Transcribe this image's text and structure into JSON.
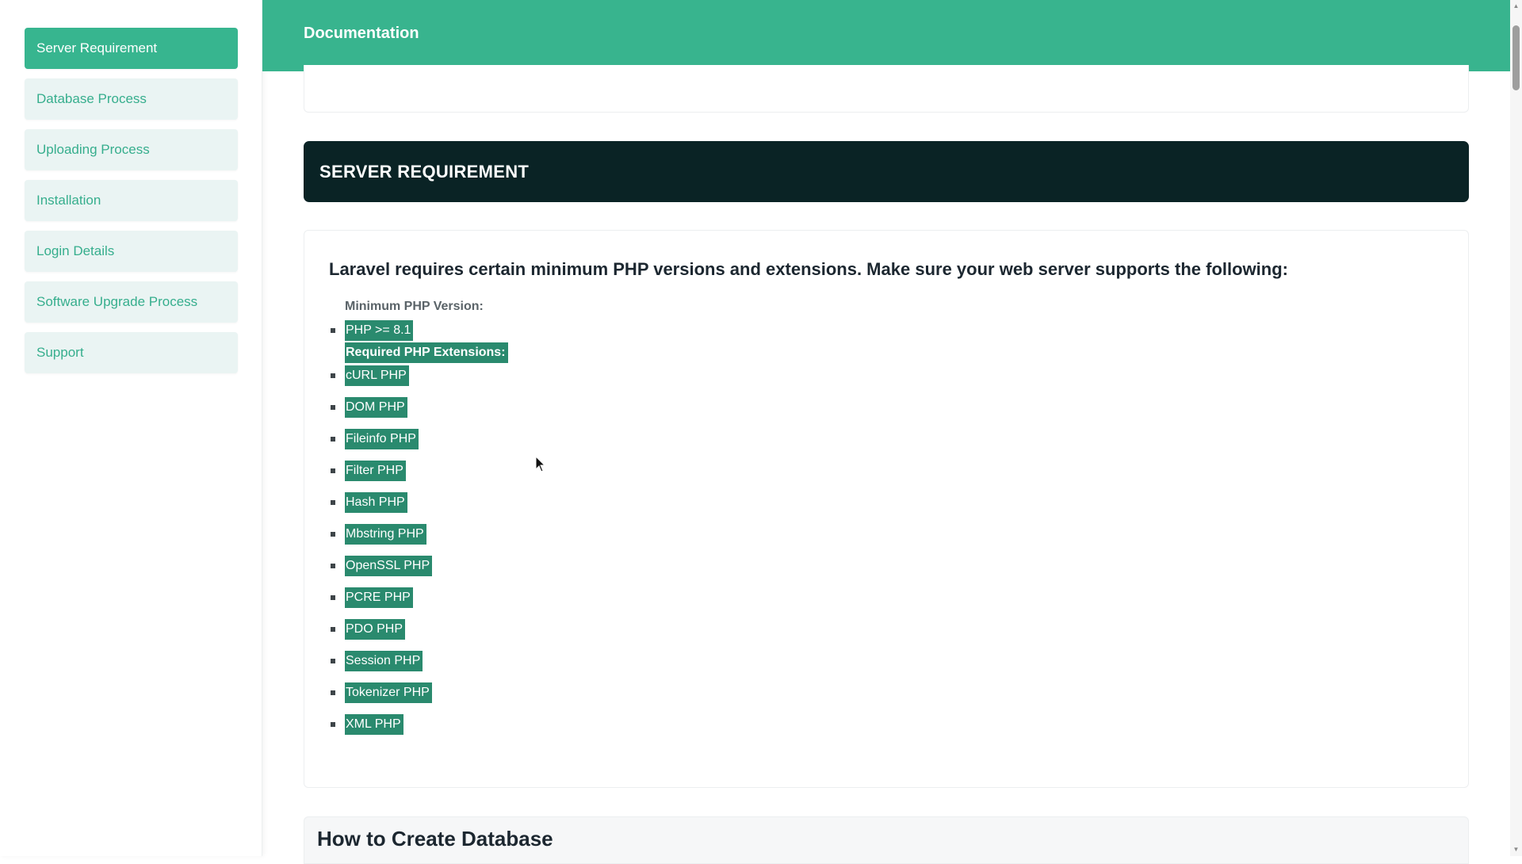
{
  "sidebar": {
    "items": [
      {
        "label": "Server Requirement",
        "active": true
      },
      {
        "label": "Database Process",
        "active": false
      },
      {
        "label": "Uploading Process",
        "active": false
      },
      {
        "label": "Installation",
        "active": false
      },
      {
        "label": "Login Details",
        "active": false
      },
      {
        "label": "Software Upgrade Process",
        "active": false
      },
      {
        "label": "Support",
        "active": false
      }
    ]
  },
  "header": {
    "title": "Documentation"
  },
  "section": {
    "title": "SERVER REQUIREMENT",
    "intro": "Laravel requires certain minimum PHP versions and extensions. Make sure your web server supports the following:",
    "min_version_label": "Minimum PHP Version:",
    "min_version_value": "PHP >= 8.1",
    "extensions_label": "Required PHP Extensions:",
    "extensions": [
      "cURL PHP",
      "DOM PHP",
      "Fileinfo PHP",
      "Filter PHP",
      "Hash PHP",
      "Mbstring PHP",
      "OpenSSL PHP",
      "PCRE PHP",
      "PDO PHP",
      "Session PHP",
      "Tokenizer PHP",
      "XML PHP"
    ]
  },
  "next_section": {
    "title": "How to Create Database"
  },
  "colors": {
    "brand_green": "#38b48e",
    "sidebar_item_bg": "#eaf4f3",
    "header_dark": "#0a2325",
    "highlight": "#2a8a6e"
  }
}
